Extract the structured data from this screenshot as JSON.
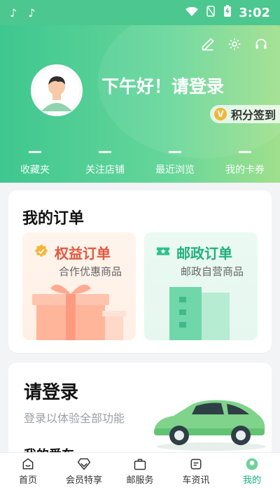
{
  "statusbar": {
    "app_icons": [
      "tiktok-icon",
      "tiktok-icon"
    ],
    "time": "3:02",
    "icons": [
      "wifi-icon",
      "no-sim-icon",
      "battery-charging-icon"
    ]
  },
  "header": {
    "greeting": "下午好！请登录",
    "points_signin": "积分签到",
    "icons": [
      "edit-icon",
      "settings-icon",
      "headset-icon"
    ],
    "stats": [
      {
        "value": "—",
        "label": "收藏夹"
      },
      {
        "value": "—",
        "label": "关注店铺"
      },
      {
        "value": "—",
        "label": "最近浏览"
      },
      {
        "value": "—",
        "label": "我的卡券"
      }
    ]
  },
  "orders": {
    "title": "我的订单",
    "tiles": [
      {
        "title": "权益订单",
        "subtitle": "合作优惠商品",
        "icon": "benefit-icon"
      },
      {
        "title": "邮政订单",
        "subtitle": "邮政自营商品",
        "icon": "postal-ticket-icon"
      }
    ]
  },
  "login_card": {
    "title": "请登录",
    "subtitle": "登录以体验全部功能",
    "my_cars": "我的爱车"
  },
  "bottom_nav": [
    {
      "label": "首页",
      "icon": "home-icon",
      "active": false
    },
    {
      "label": "会员特享",
      "icon": "diamond-icon",
      "active": false
    },
    {
      "label": "邮服务",
      "icon": "briefcase-icon",
      "active": false
    },
    {
      "label": "车资讯",
      "icon": "car-info-icon",
      "active": false
    },
    {
      "label": "我的",
      "icon": "profile-icon",
      "active": true
    }
  ],
  "colors": {
    "header_start": "#3ec78f",
    "header_end": "#9fe08d",
    "accent_green": "#17b67a",
    "benefit_red": "#e4573f",
    "postal_green": "#22b07b",
    "coin_yellow": "#f4b537"
  }
}
